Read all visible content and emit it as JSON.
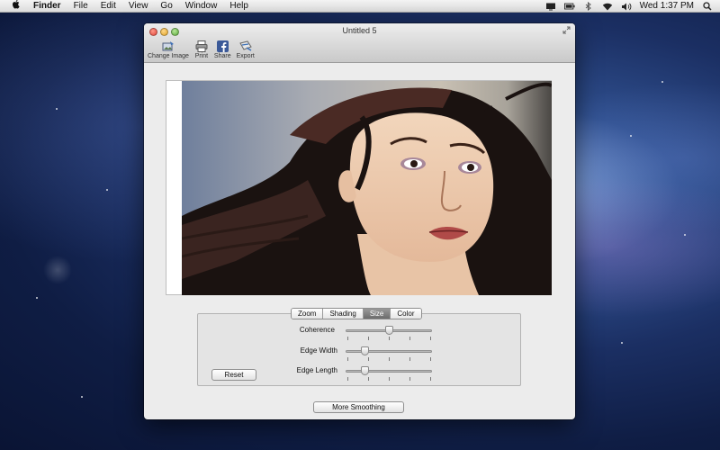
{
  "menubar": {
    "items": [
      "Finder",
      "File",
      "Edit",
      "View",
      "Go",
      "Window",
      "Help"
    ],
    "clock": "Wed 1:37 PM"
  },
  "window": {
    "title": "Untitled 5",
    "toolbar": {
      "change_image": "Change Image",
      "print": "Print",
      "share": "Share",
      "export": "Export"
    }
  },
  "panel": {
    "tabs": [
      "Zoom",
      "Shading",
      "Size",
      "Color"
    ],
    "active_tab": "Size",
    "sliders": [
      {
        "label": "Coherence",
        "value": 0.5
      },
      {
        "label": "Edge Width",
        "value": 0.2
      },
      {
        "label": "Edge Length",
        "value": 0.2
      }
    ],
    "reset_label": "Reset"
  },
  "more_smoothing_label": "More Smoothing",
  "colors": {
    "accent_active_tab": "#7a7a7a",
    "desktop": "#1b2f63"
  }
}
